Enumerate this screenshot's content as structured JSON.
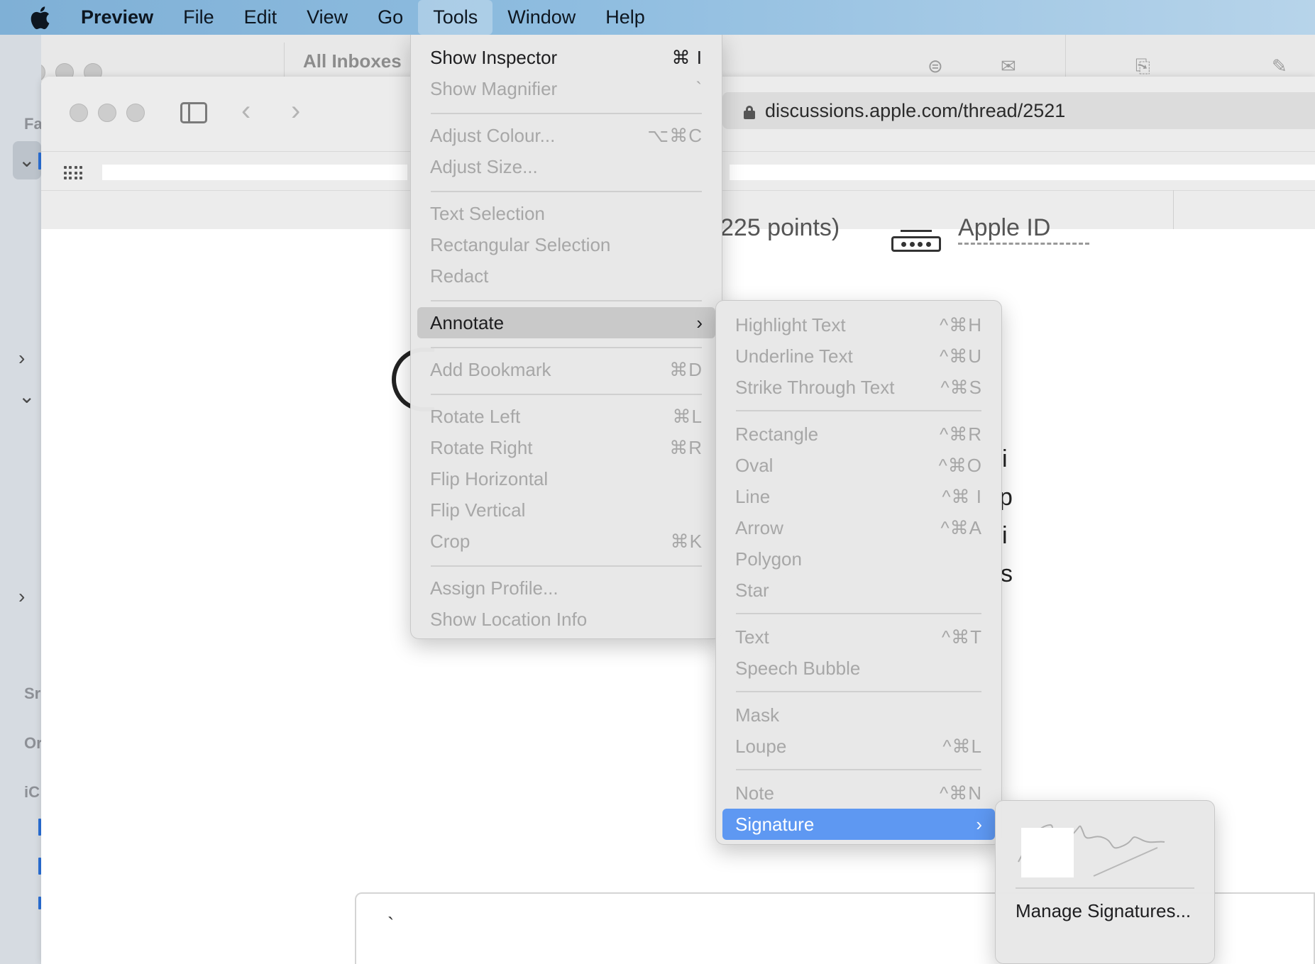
{
  "menubar": {
    "app": "Preview",
    "items": [
      "File",
      "Edit",
      "View",
      "Go",
      "Tools",
      "Window",
      "Help"
    ],
    "active": "Tools"
  },
  "mail": {
    "inbox_title": "All Inboxes",
    "sidebar_fragments": [
      "Fa",
      "Sr",
      "Or",
      "iC"
    ]
  },
  "browser": {
    "url": "discussions.apple.com/thread/2521"
  },
  "page": {
    "fragment_points": "225 points)",
    "fragment_id": "Apple ID",
    "right_glyphs": [
      "i",
      "p",
      "i",
      "s"
    ],
    "comment_mark": "`"
  },
  "tools_menu": {
    "items": [
      {
        "label": "Show Inspector",
        "shortcut": "⌘ I",
        "enabled": true
      },
      {
        "label": "Show Magnifier",
        "shortcut": "`",
        "enabled": false
      },
      {
        "label": "Adjust Colour...",
        "shortcut": "⌥⌘C",
        "enabled": false
      },
      {
        "label": "Adjust Size...",
        "shortcut": "",
        "enabled": false
      },
      {
        "label": "Text Selection",
        "shortcut": "",
        "enabled": false
      },
      {
        "label": "Rectangular Selection",
        "shortcut": "",
        "enabled": false
      },
      {
        "label": "Redact",
        "shortcut": "",
        "enabled": false
      },
      {
        "label": "Annotate",
        "shortcut": "",
        "enabled": true,
        "submenu": true
      },
      {
        "label": "Add Bookmark",
        "shortcut": "⌘D",
        "enabled": false
      },
      {
        "label": "Rotate Left",
        "shortcut": "⌘L",
        "enabled": false
      },
      {
        "label": "Rotate Right",
        "shortcut": "⌘R",
        "enabled": false
      },
      {
        "label": "Flip Horizontal",
        "shortcut": "",
        "enabled": false
      },
      {
        "label": "Flip Vertical",
        "shortcut": "",
        "enabled": false
      },
      {
        "label": "Crop",
        "shortcut": "⌘K",
        "enabled": false
      },
      {
        "label": "Assign Profile...",
        "shortcut": "",
        "enabled": false
      },
      {
        "label": "Show Location Info",
        "shortcut": "",
        "enabled": false
      }
    ]
  },
  "annotate_menu": {
    "items": [
      {
        "label": "Highlight Text",
        "shortcut": "^⌘H"
      },
      {
        "label": "Underline Text",
        "shortcut": "^⌘U"
      },
      {
        "label": "Strike Through Text",
        "shortcut": "^⌘S"
      },
      {
        "label": "Rectangle",
        "shortcut": "^⌘R"
      },
      {
        "label": "Oval",
        "shortcut": "^⌘O"
      },
      {
        "label": "Line",
        "shortcut": "^⌘ I"
      },
      {
        "label": "Arrow",
        "shortcut": "^⌘A"
      },
      {
        "label": "Polygon",
        "shortcut": ""
      },
      {
        "label": "Star",
        "shortcut": ""
      },
      {
        "label": "Text",
        "shortcut": "^⌘T"
      },
      {
        "label": "Speech Bubble",
        "shortcut": ""
      },
      {
        "label": "Mask",
        "shortcut": ""
      },
      {
        "label": "Loupe",
        "shortcut": "^⌘L"
      },
      {
        "label": "Note",
        "shortcut": "^⌘N"
      },
      {
        "label": "Signature",
        "shortcut": "",
        "submenu": true,
        "selected": true
      }
    ]
  },
  "signature_menu": {
    "manage_label": "Manage Signatures..."
  },
  "colors": {
    "selection_blue": "#5e98f2",
    "menu_hover": "#c9c9c9"
  }
}
